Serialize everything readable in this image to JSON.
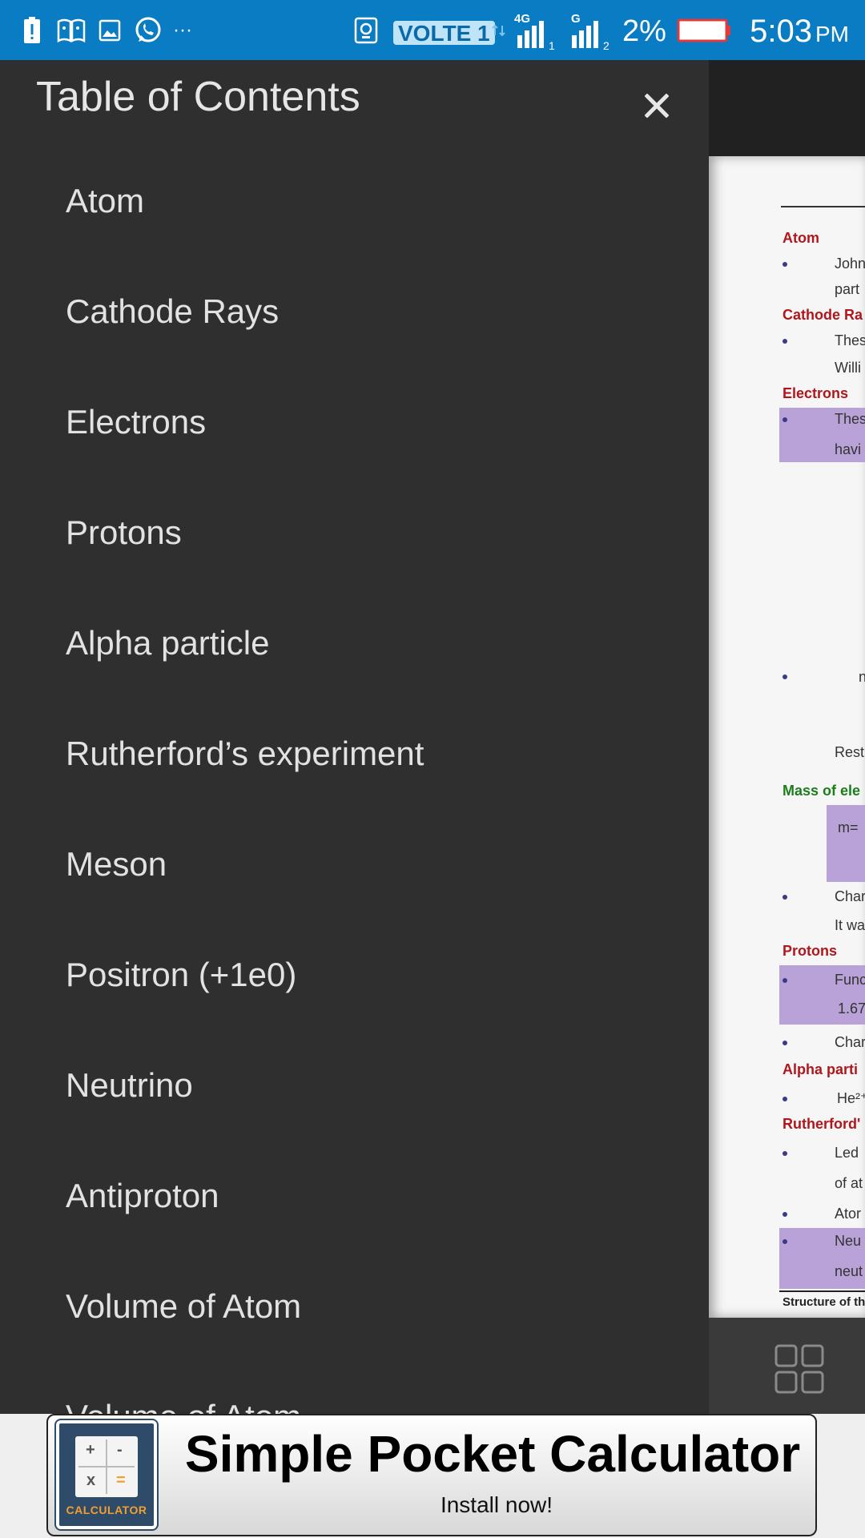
{
  "status_bar": {
    "time": "5:03",
    "ampm": "PM",
    "battery_percent": "2%",
    "volte": "VOLTE 1",
    "net_sim1": "4G",
    "net_sim2": "G",
    "more": "···"
  },
  "toc": {
    "title": "Table of Contents",
    "items": [
      "Atom",
      "Cathode Rays",
      "Electrons",
      "Protons",
      "Alpha particle",
      "Rutherford’s experiment",
      "Meson",
      "Positron (+1e0)",
      "Neutrino",
      "Antiproton",
      "Volume of Atom",
      "Volume of Atom"
    ]
  },
  "document": {
    "snippets": {
      "atom": "Atom",
      "john": "John",
      "part": "part",
      "cathode": "Cathode Ra",
      "thes1": "Thes",
      "willi": "Willi",
      "electrons": "Electrons",
      "thes2": "Thes",
      "havi": "havi",
      "n": "n",
      "rest": "Rest",
      "mass": "Mass of ele",
      "m": "m=",
      "char1": "Char",
      "itwa": "It wa",
      "protons": "Protons",
      "func": "Func",
      "num": "1.67",
      "char2": "Char",
      "alpha": "Alpha parti",
      "he": "He²⁺",
      "ruth": "Rutherford'",
      "led": "Led",
      "ofat": "of at",
      "ator": "Ator",
      "neu": "Neu",
      "neut": "neut",
      "structure": "Structure of th"
    }
  },
  "ad": {
    "title": "Simple Pocket Calculator",
    "subtitle": "Install now!",
    "logo_text": "CALCULATOR",
    "glyphs": [
      "+",
      "-",
      "x",
      "="
    ]
  }
}
